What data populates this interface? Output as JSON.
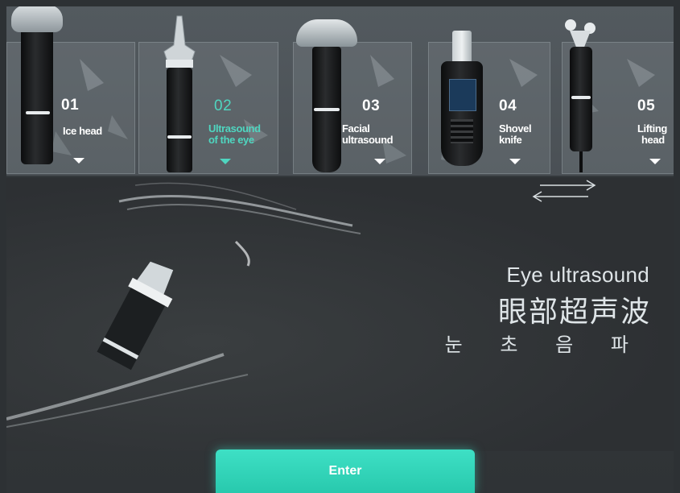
{
  "tools": [
    {
      "number": "01",
      "label_line1": "Ice head",
      "label_line2": "",
      "active": false
    },
    {
      "number": "02",
      "label_line1": "Ultrasound",
      "label_line2": "of the eye",
      "active": true
    },
    {
      "number": "03",
      "label_line1": "Facial",
      "label_line2": "ultrasound",
      "active": false
    },
    {
      "number": "04",
      "label_line1": "Shovel",
      "label_line2": "knife",
      "active": false
    },
    {
      "number": "05",
      "label_line1": "Lifting",
      "label_line2": "head",
      "active": false
    }
  ],
  "detail": {
    "title_en": "Eye ultrasound",
    "title_zh": "眼部超声波",
    "title_ko": "눈 초 음 파"
  },
  "enter_label": "Enter",
  "colors": {
    "accent": "#4fd6c0",
    "button": "#2fd4b8"
  },
  "icons": {
    "swap": "swap-arrows-icon",
    "select": "triangle-down-icon"
  }
}
